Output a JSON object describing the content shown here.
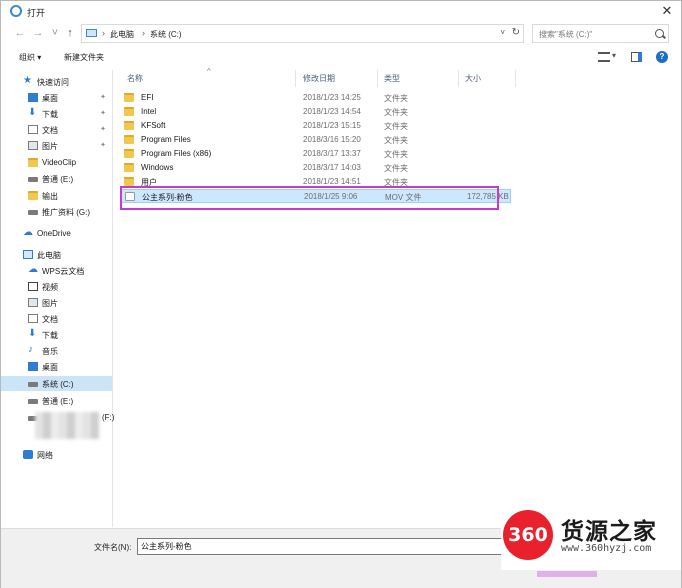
{
  "window": {
    "title": "打开",
    "close_glyph": "✕"
  },
  "address_bar": {
    "back": "←",
    "forward": "→",
    "recent": "˅",
    "up": "↑",
    "crumbs": [
      "此电脑",
      "系统 (C:)"
    ],
    "separator": "›",
    "dropdown": "˅",
    "refresh": "↻"
  },
  "search": {
    "placeholder": "搜索\"系统 (C:)\""
  },
  "toolbar": {
    "organize_label": "组织 ▾",
    "new_folder_label": "新建文件夹",
    "view_dropdown": "▾",
    "help": "?"
  },
  "sidebar": {
    "items": [
      {
        "label": "快速访问",
        "icon": "star-icon",
        "pinned": false
      },
      {
        "label": "桌面",
        "icon": "desktop-icon",
        "pinned": true
      },
      {
        "label": "下载",
        "icon": "download-icon",
        "pinned": true
      },
      {
        "label": "文档",
        "icon": "document-icon",
        "pinned": true
      },
      {
        "label": "图片",
        "icon": "picture-icon",
        "pinned": true
      },
      {
        "label": "VideoClip",
        "icon": "folder-icon",
        "pinned": false
      },
      {
        "label": "普通 (E:)",
        "icon": "drive-icon",
        "pinned": false
      },
      {
        "label": "输出",
        "icon": "folder-icon",
        "pinned": false
      },
      {
        "label": "推广资料 (G:)",
        "icon": "drive-icon",
        "pinned": false
      },
      {
        "label": "OneDrive",
        "icon": "cloud-icon",
        "pinned": false
      },
      {
        "label": "此电脑",
        "icon": "computer-icon",
        "pinned": false
      },
      {
        "label": "WPS云文档",
        "icon": "cloud-icon",
        "pinned": false
      },
      {
        "label": "视频",
        "icon": "video-icon",
        "pinned": false
      },
      {
        "label": "图片",
        "icon": "picture-icon",
        "pinned": false
      },
      {
        "label": "文档",
        "icon": "document-icon",
        "pinned": false
      },
      {
        "label": "下载",
        "icon": "download-icon",
        "pinned": false
      },
      {
        "label": "音乐",
        "icon": "music-icon",
        "pinned": false
      },
      {
        "label": "桌面",
        "icon": "desktop-icon",
        "pinned": false
      },
      {
        "label": "系统 (C:)",
        "icon": "drive-icon",
        "pinned": false,
        "selected": true
      },
      {
        "label": "普通 (E:)",
        "icon": "drive-icon",
        "pinned": false
      },
      {
        "label": "(F:)",
        "icon": "drive-icon",
        "pinned": false
      },
      {
        "label": "网络",
        "icon": "network-icon",
        "pinned": false
      }
    ],
    "pin_glyph": "✦"
  },
  "filelist": {
    "columns": {
      "name": "名称",
      "date": "修改日期",
      "type": "类型",
      "size": "大小"
    },
    "sort_caret": "^",
    "rows": [
      {
        "name": "EFI",
        "date": "2018/1/23 14:25",
        "type": "文件夹",
        "size": "",
        "kind": "folder"
      },
      {
        "name": "Intel",
        "date": "2018/1/23 14:54",
        "type": "文件夹",
        "size": "",
        "kind": "folder"
      },
      {
        "name": "KFSoft",
        "date": "2018/1/23 15:15",
        "type": "文件夹",
        "size": "",
        "kind": "folder"
      },
      {
        "name": "Program Files",
        "date": "2018/3/16 15:20",
        "type": "文件夹",
        "size": "",
        "kind": "folder"
      },
      {
        "name": "Program Files (x86)",
        "date": "2018/3/17 13:37",
        "type": "文件夹",
        "size": "",
        "kind": "folder"
      },
      {
        "name": "Windows",
        "date": "2018/3/17 14:03",
        "type": "文件夹",
        "size": "",
        "kind": "folder"
      },
      {
        "name": "用户",
        "date": "2018/1/23 14:51",
        "type": "文件夹",
        "size": "",
        "kind": "folder"
      },
      {
        "name": "公主系列-粉色",
        "date": "2018/1/25 9:06",
        "type": "MOV 文件",
        "size": "172,785 KB",
        "kind": "file",
        "selected": true
      }
    ]
  },
  "bottom": {
    "filename_label": "文件名(N):",
    "filename_value": "公主系列-粉色"
  },
  "watermark": {
    "badge": "360",
    "title": "货源之家",
    "url": "www.360hyzj.com"
  },
  "colors": {
    "accent": "#2f7cd3",
    "selection": "#cce8ff",
    "highlight_box": "#c23bd3",
    "watermark_red": "#e9212d"
  }
}
